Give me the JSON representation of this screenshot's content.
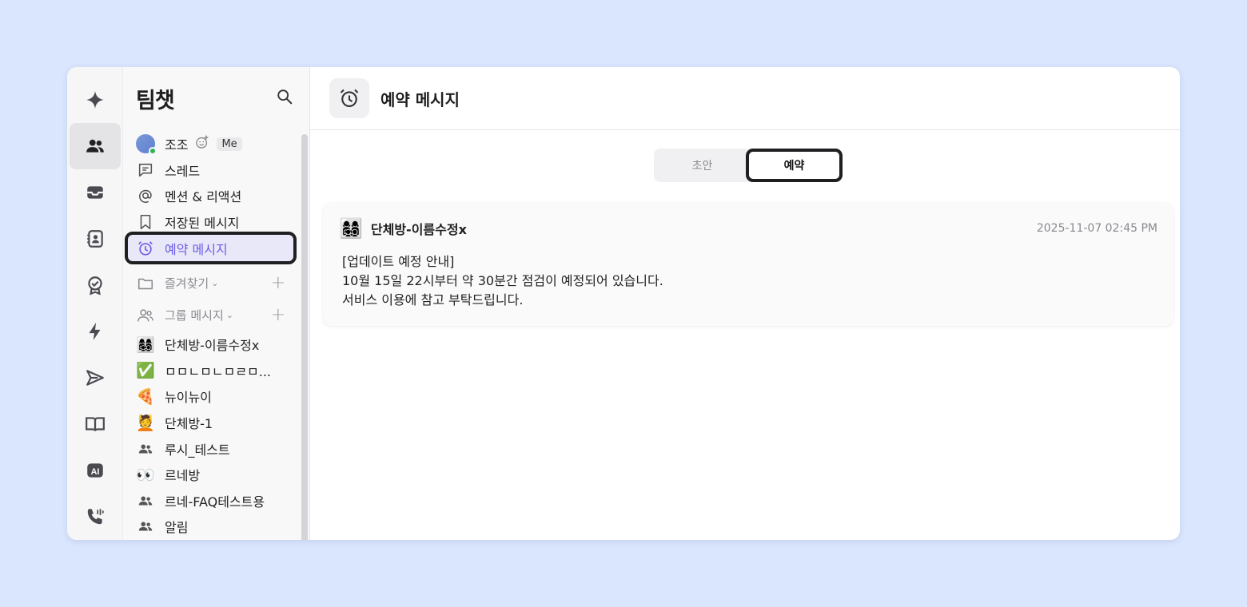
{
  "sidebar": {
    "title": "팀챗",
    "me": {
      "name": "조조",
      "badge": "Me"
    },
    "nav": [
      {
        "label": "스레드",
        "icon": "thread-icon"
      },
      {
        "label": "멘션 & 리액션",
        "icon": "at-icon"
      },
      {
        "label": "저장된 메시지",
        "icon": "bookmark-icon"
      },
      {
        "label": "예약 메시지",
        "icon": "alarm-clock-icon"
      }
    ],
    "favorites": {
      "label": "즐겨찾기"
    },
    "groups": {
      "label": "그룹 메시지",
      "items": [
        {
          "emoji": "👩‍👩‍👧‍👦",
          "label": "단체방-이름수정x"
        },
        {
          "emoji": "✅",
          "label": "ㅁㅁㄴㅁㄴㅁㄹㅁ..."
        },
        {
          "emoji": "🍕",
          "label": "뉴이뉴이"
        },
        {
          "emoji": "💆",
          "label": "단체방-1"
        },
        {
          "emoji": "people",
          "label": "루시_테스트"
        },
        {
          "emoji": "👀",
          "label": "르네방"
        },
        {
          "emoji": "people",
          "label": "르네-FAQ테스트용"
        },
        {
          "emoji": "people",
          "label": "알림"
        }
      ]
    }
  },
  "header": {
    "title": "예약 메시지"
  },
  "tabs": {
    "draft": "초안",
    "scheduled": "예약"
  },
  "message": {
    "emoji": "👩‍👩‍👧‍👦",
    "room": "단체방-이름수정x",
    "time": "2025-11-07 02:45 PM",
    "lines": [
      "[업데이트 예정 안내]",
      "10월 15일 22시부터 약 30분간 점검이 예정되어 있습니다.",
      "서비스 이용에 참고 부탁드립니다."
    ]
  },
  "colors": {
    "accent": "#6b5ce8",
    "background": "#d9e6fd",
    "online": "#2fb35b"
  }
}
